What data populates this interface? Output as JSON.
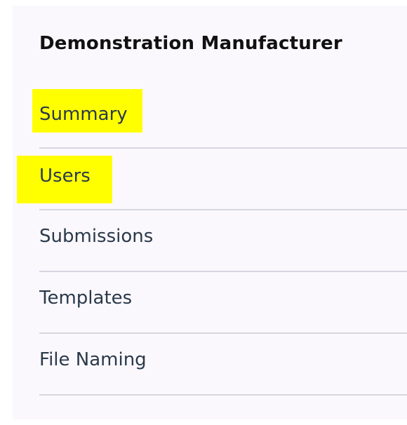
{
  "sidebar": {
    "organization_name": "Demonstration Manufacturer",
    "items": [
      {
        "label": "Summary",
        "highlighted": true
      },
      {
        "label": "Users",
        "highlighted": true
      },
      {
        "label": "Submissions",
        "highlighted": false
      },
      {
        "label": "Templates",
        "highlighted": false
      },
      {
        "label": "File Naming",
        "highlighted": false
      }
    ]
  },
  "colors": {
    "panel_background": "#fbf8fd",
    "highlight": "#ffff00",
    "divider": "#d5d6df",
    "link_text": "#2a3a4a"
  }
}
